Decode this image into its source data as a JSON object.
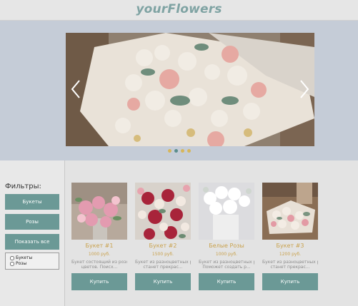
{
  "header": {
    "logo": "yourFlowers"
  },
  "carousel": {
    "prev_icon": "chevron-left-icon",
    "next_icon": "chevron-right-icon",
    "dots_count": 4,
    "active_dot": 1
  },
  "sidebar": {
    "title": "Фильтры:",
    "buttons": [
      "Букеты",
      "Розы",
      "Показать все"
    ],
    "checkboxes": [
      {
        "label": "Букеты",
        "checked": false
      },
      {
        "label": "Розы",
        "checked": false
      }
    ]
  },
  "products": [
    {
      "title": "Букет #1",
      "price": "1000 руб.",
      "desc": [
        "Букет состоящий из розовых",
        "цветов. Поисх..."
      ],
      "buy_label": "Купить"
    },
    {
      "title": "Букет #2",
      "price": "1500 руб.",
      "desc": [
        "Букет из разноцветных роз",
        "станет прекрас..."
      ],
      "buy_label": "Купить"
    },
    {
      "title": "Белые Розы",
      "price": "1000 руб.",
      "desc": [
        "Букет из разноцветных роз",
        "Поможет создать р..."
      ],
      "buy_label": "Купить"
    },
    {
      "title": "Букет #3",
      "price": "1200 руб.",
      "desc": [
        "Букет из разноцветных роз",
        "станет прекрас..."
      ],
      "buy_label": "Купить"
    }
  ],
  "colors": {
    "accent": "#6b9996",
    "logo": "#7fa3a3",
    "price": "#c9a24e",
    "hero_bg": "#c5ccd7"
  }
}
